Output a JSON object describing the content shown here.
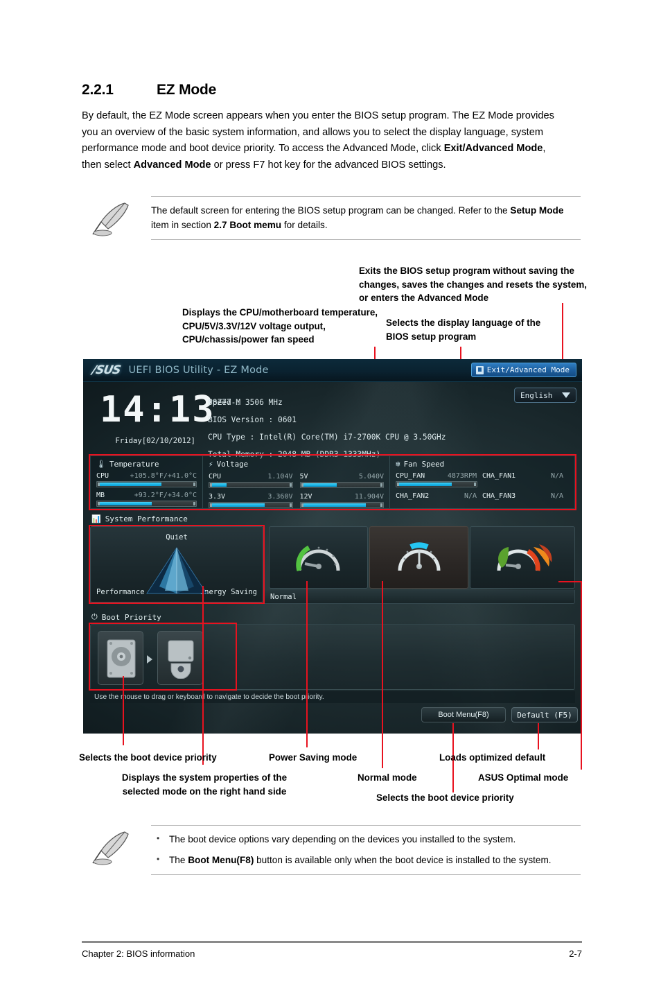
{
  "section": {
    "number": "2.2.1",
    "title": "EZ Mode",
    "body_html": "By default, the EZ Mode screen appears when you enter the BIOS setup program. The EZ Mode provides you an overview of the basic system information, and allows you to select the display language, system performance mode and boot device priority. To access the Advanced Mode, click <b>Exit/Advanced Mode</b>, then select <b>Advanced Mode</b> or press F7 hot key for the advanced BIOS settings."
  },
  "note_top": {
    "html": "The default screen for entering the BIOS setup program can be changed. Refer to the <b>Setup Mode</b> item in section <b>2.7 Boot memu</b> for details."
  },
  "note_bottom": {
    "bullets_html": [
      "The boot device options vary depending on the devices you installed to the system.",
      "The <b>Boot Menu(F8)</b> button is available only when the boot device is installed to the system."
    ]
  },
  "callouts": {
    "exit": "Exits the BIOS setup program without saving the changes, saves the changes and resets the system, or enters the Advanced Mode",
    "temperature": "Displays the CPU/motherboard temperature, CPU/5V/3.3V/12V voltage output, CPU/chassis/power fan speed",
    "language": "Selects the display language of the BIOS setup program",
    "boot_device_priority_left": "Selects the boot device  priority",
    "power_saving": "Power Saving mode",
    "loads_default": "Loads optimized default",
    "displays_properties": "Displays the system properties of the selected mode on the right hand side",
    "normal_mode": "Normal mode",
    "asus_optimal": "ASUS Optimal mode",
    "boot_device_priority_right": "Selects the boot device priority"
  },
  "bios": {
    "brand": "/SUS",
    "title": "UEFI BIOS Utility - EZ Mode",
    "exit_button": "Exit/Advanced Mode",
    "language_select": "English",
    "clock": {
      "time": "14:13",
      "date": "Friday[02/10/2012]"
    },
    "system_info": {
      "model": "P8Z77-M",
      "bios_version": "BIOS Version : 0601",
      "cpu_type": "CPU Type : Intel(R) Core(TM) i7-2700K CPU @ 3.50GHz",
      "speed": "Speed : 3506 MHz",
      "total_memory": "Total Memory : 2048 MB (DDR3 1333MHz)"
    },
    "monitor": {
      "temperature": {
        "title": "Temperature",
        "rows": [
          {
            "name": "CPU",
            "value": "+105.8°F/+41.0°C",
            "percent": 66
          },
          {
            "name": "MB",
            "value": "+93.2°F/+34.0°C",
            "percent": 56
          }
        ]
      },
      "voltage": {
        "title": "Voltage",
        "rows": [
          {
            "name": "CPU",
            "value": "1.104V",
            "percent": 22
          },
          {
            "name": "5V",
            "value": "5.040V",
            "percent": 45
          },
          {
            "name": "3.3V",
            "value": "3.360V",
            "percent": 68
          },
          {
            "name": "12V",
            "value": "11.904V",
            "percent": 80
          }
        ]
      },
      "fan_speed": {
        "title": "Fan Speed",
        "rows": [
          {
            "name": "CPU_FAN",
            "value": "4873RPM",
            "percent": 70,
            "has_bar": true
          },
          {
            "name": "CHA_FAN1",
            "value": "N/A",
            "percent": 0,
            "has_bar": false
          },
          {
            "name": "CHA_FAN2",
            "value": "N/A",
            "percent": 0,
            "has_bar": false
          },
          {
            "name": "CHA_FAN3",
            "value": "N/A",
            "percent": 0,
            "has_bar": false
          }
        ]
      }
    },
    "performance": {
      "title": "System Performance",
      "quiet_tile": {
        "top": "Quiet",
        "bottom_left": "Performance",
        "bottom_right": "Energy Saving"
      },
      "selected_label": "Normal",
      "modes": [
        "power-saving-gauge",
        "normal-gauge",
        "asus-optimal-gauge"
      ]
    },
    "boot": {
      "title": "Boot Priority",
      "devices": [
        "hard-disk-drive-icon",
        "optical-drive-icon"
      ],
      "hint": "Use the mouse to drag or keyboard to navigate to decide the boot priority.",
      "boot_menu_button": "Boot Menu(F8)",
      "default_button": "Default (F5)"
    }
  },
  "footer": {
    "left": "Chapter 2: BIOS information",
    "right": "2-7"
  },
  "colors": {
    "accent_red": "#e8121f",
    "bios_blue": "#19b5e8",
    "button_blue": "#2f7fc4"
  }
}
